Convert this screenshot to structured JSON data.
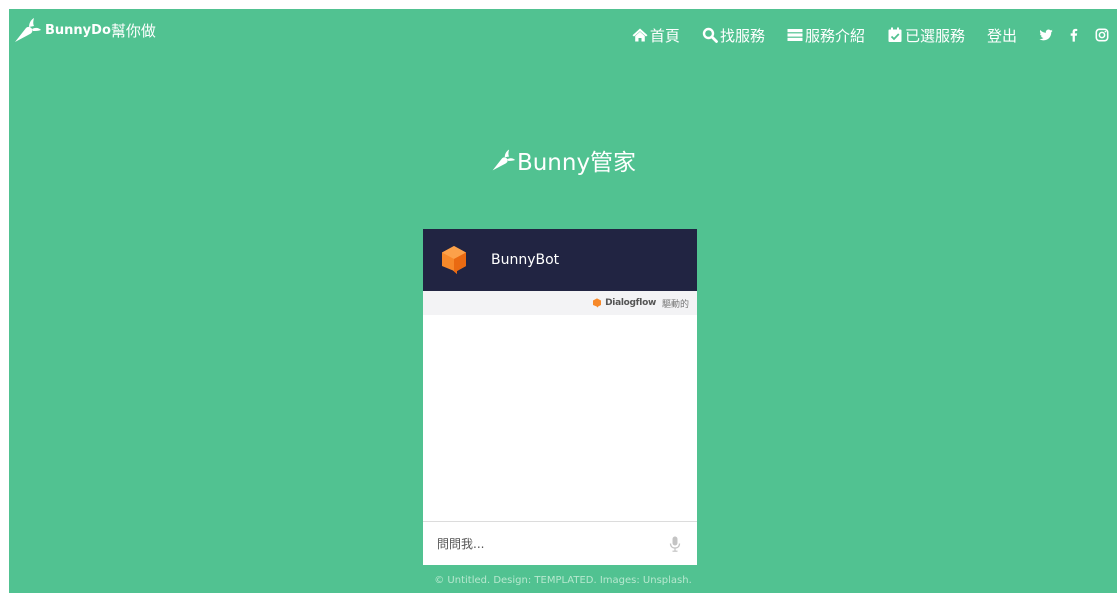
{
  "header": {
    "brand_name": "BunnyDo",
    "brand_suffix": "幫你做",
    "nav": [
      {
        "label": "首頁",
        "icon": "home-icon"
      },
      {
        "label": "找服務",
        "icon": "search-icon"
      },
      {
        "label": "服務介紹",
        "icon": "list-icon"
      },
      {
        "label": "已選服務",
        "icon": "calendar-check-icon"
      },
      {
        "label": "登出",
        "icon": ""
      }
    ],
    "social": [
      "twitter-icon",
      "facebook-icon",
      "instagram-icon"
    ]
  },
  "hero": {
    "title": "Bunny管家"
  },
  "chat": {
    "bot_name": "BunnyBot",
    "powered_by": "Dialogflow",
    "powered_suffix": "驅動的",
    "input_placeholder": "問問我..."
  },
  "footer": {
    "text": "© Untitled. Design: TEMPLATED. Images: Unsplash."
  },
  "colors": {
    "background": "#51c291",
    "chat_header": "#212442",
    "accent_orange": "#f7892a"
  }
}
